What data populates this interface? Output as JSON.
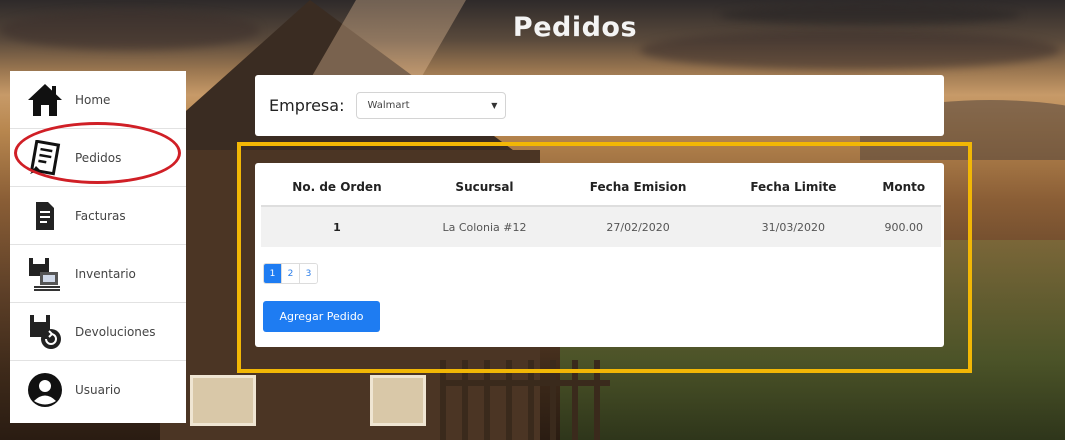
{
  "header": {
    "title": "Pedidos"
  },
  "sidebar": {
    "items": [
      {
        "label": "Home",
        "icon": "home-icon"
      },
      {
        "label": "Pedidos",
        "icon": "orders-document-icon"
      },
      {
        "label": "Facturas",
        "icon": "invoice-icon"
      },
      {
        "label": "Inventario",
        "icon": "inventory-icon"
      },
      {
        "label": "Devoluciones",
        "icon": "returns-icon"
      },
      {
        "label": "Usuario",
        "icon": "user-icon"
      }
    ]
  },
  "empresa": {
    "label": "Empresa:",
    "selected": "Walmart"
  },
  "table": {
    "headers": [
      "No. de Orden",
      "Sucursal",
      "Fecha Emision",
      "Fecha Limite",
      "Monto"
    ],
    "rows": [
      [
        "1",
        "La Colonia #12",
        "27/02/2020",
        "31/03/2020",
        "900.00"
      ]
    ]
  },
  "pagination": {
    "pages": [
      "1",
      "2",
      "3"
    ],
    "current": "1"
  },
  "actions": {
    "add_label": "Agregar Pedido"
  },
  "colors": {
    "primary": "#1e7cf2",
    "highlight_frame": "#f2b705",
    "circle_mark": "#d01f26"
  }
}
